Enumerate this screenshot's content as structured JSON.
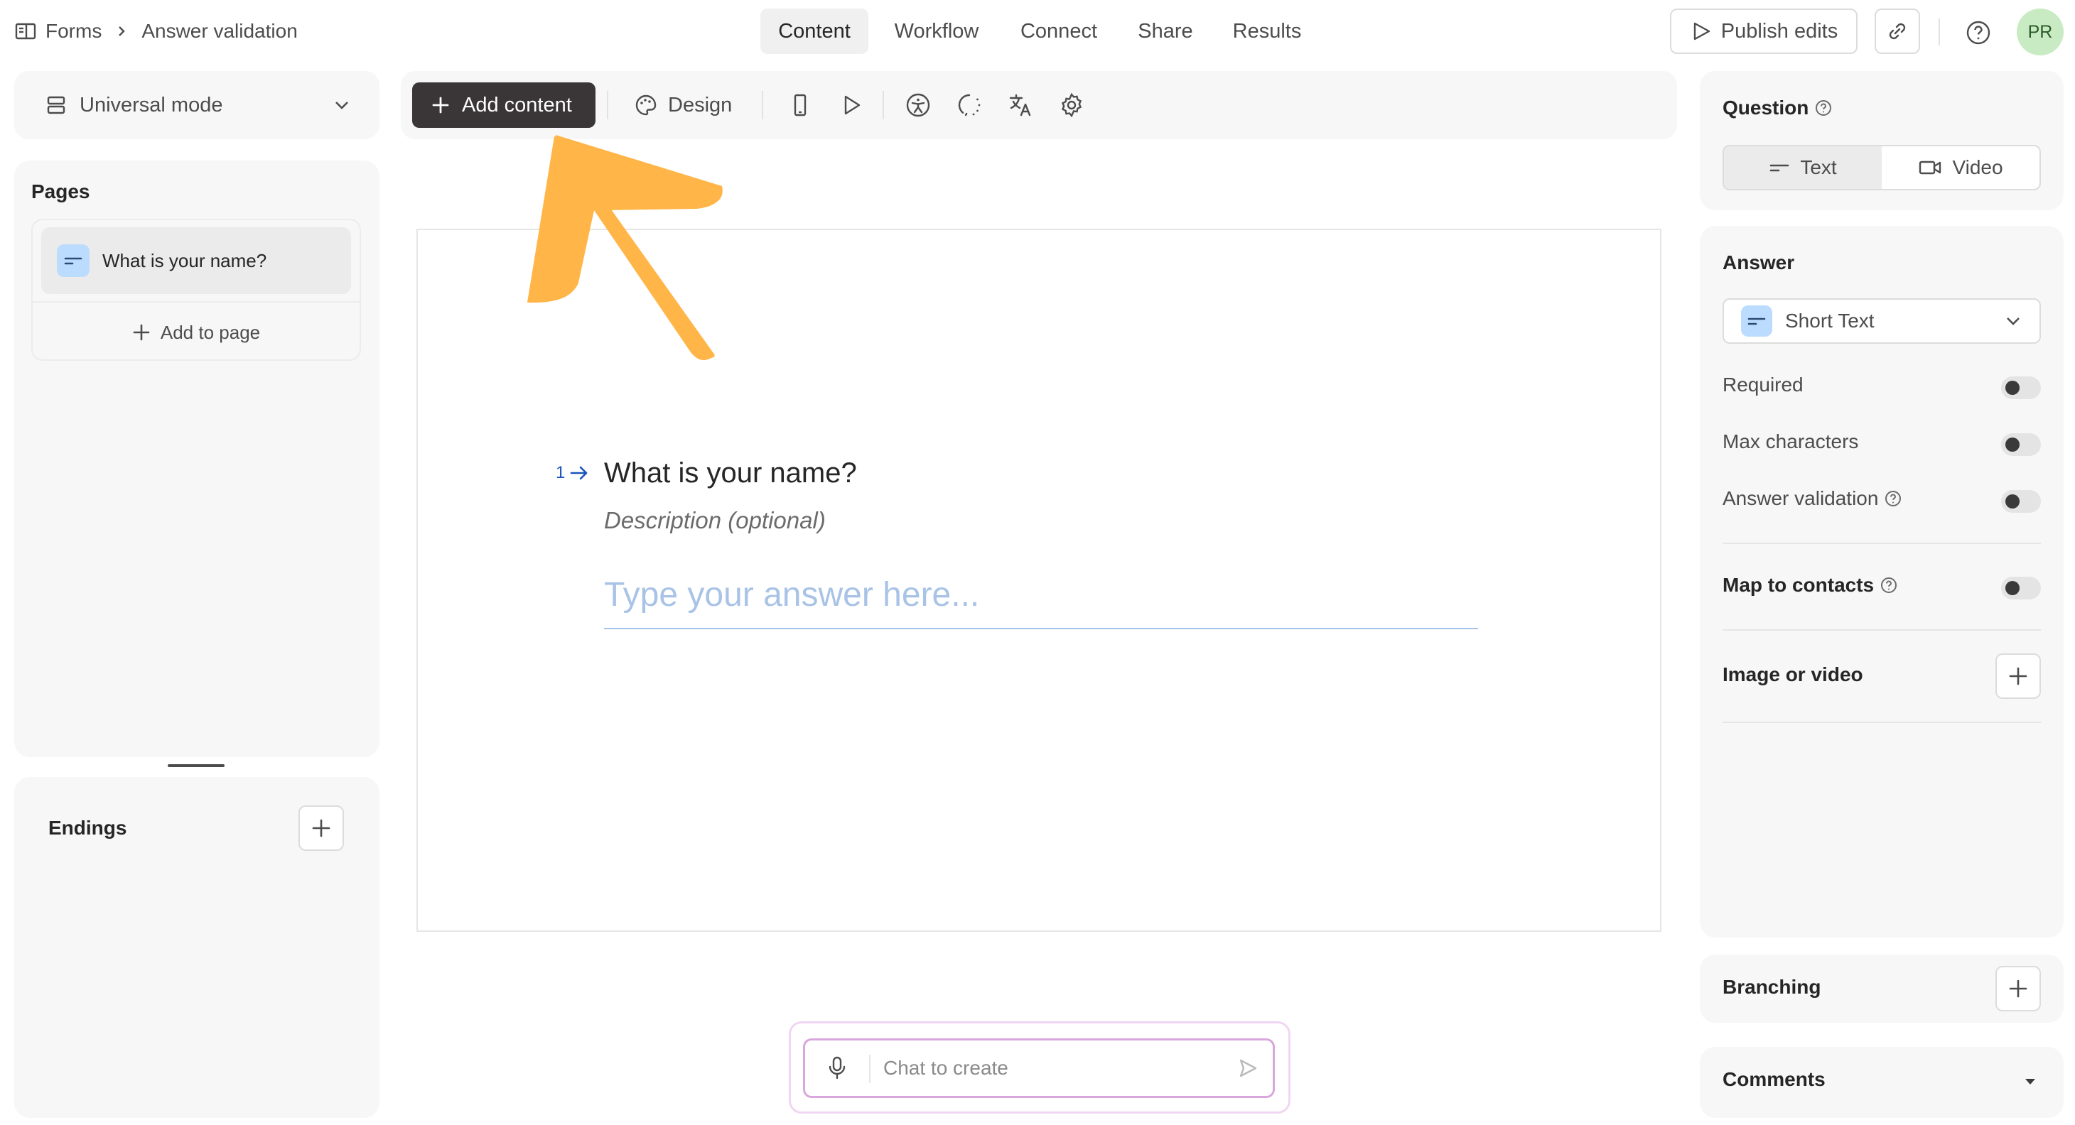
{
  "breadcrumb": {
    "root": "Forms",
    "current": "Answer validation"
  },
  "nav": {
    "tabs": [
      "Content",
      "Workflow",
      "Connect",
      "Share",
      "Results"
    ],
    "active": "Content"
  },
  "header": {
    "publish_label": "Publish edits",
    "avatar_initials": "PR"
  },
  "left": {
    "mode_label": "Universal mode",
    "pages_title": "Pages",
    "pages": [
      {
        "label": "What is your name?",
        "icon": "short-text-icon"
      }
    ],
    "add_to_page": "Add to page",
    "endings_title": "Endings"
  },
  "toolbar": {
    "add_content_label": "Add content",
    "design_label": "Design",
    "icons": [
      "mobile-preview-icon",
      "play-preview-icon",
      "accessibility-icon",
      "loading-icon",
      "translate-icon",
      "settings-icon"
    ]
  },
  "question": {
    "number": "1",
    "title": "What is your name?",
    "description_placeholder": "Description (optional)",
    "answer_placeholder": "Type your answer here..."
  },
  "chat": {
    "placeholder": "Chat to create"
  },
  "right": {
    "question_title": "Question",
    "question_types": [
      "Text",
      "Video"
    ],
    "question_type_active": "Text",
    "answer_title": "Answer",
    "answer_type": "Short Text",
    "options": [
      {
        "label": "Required",
        "enabled": false
      },
      {
        "label": "Max characters",
        "enabled": false
      },
      {
        "label": "Answer validation",
        "enabled": false
      }
    ],
    "map_to_contacts": {
      "label": "Map to contacts",
      "enabled": false
    },
    "image_or_video": "Image or video",
    "branching": "Branching",
    "comments": "Comments"
  },
  "colors": {
    "accent_dark": "#3a3638",
    "arrow": "#ffb547",
    "avatar_bg": "#c8ebc3",
    "short_text_badge": "#bcdcff",
    "question_number": "#1a55b8"
  }
}
